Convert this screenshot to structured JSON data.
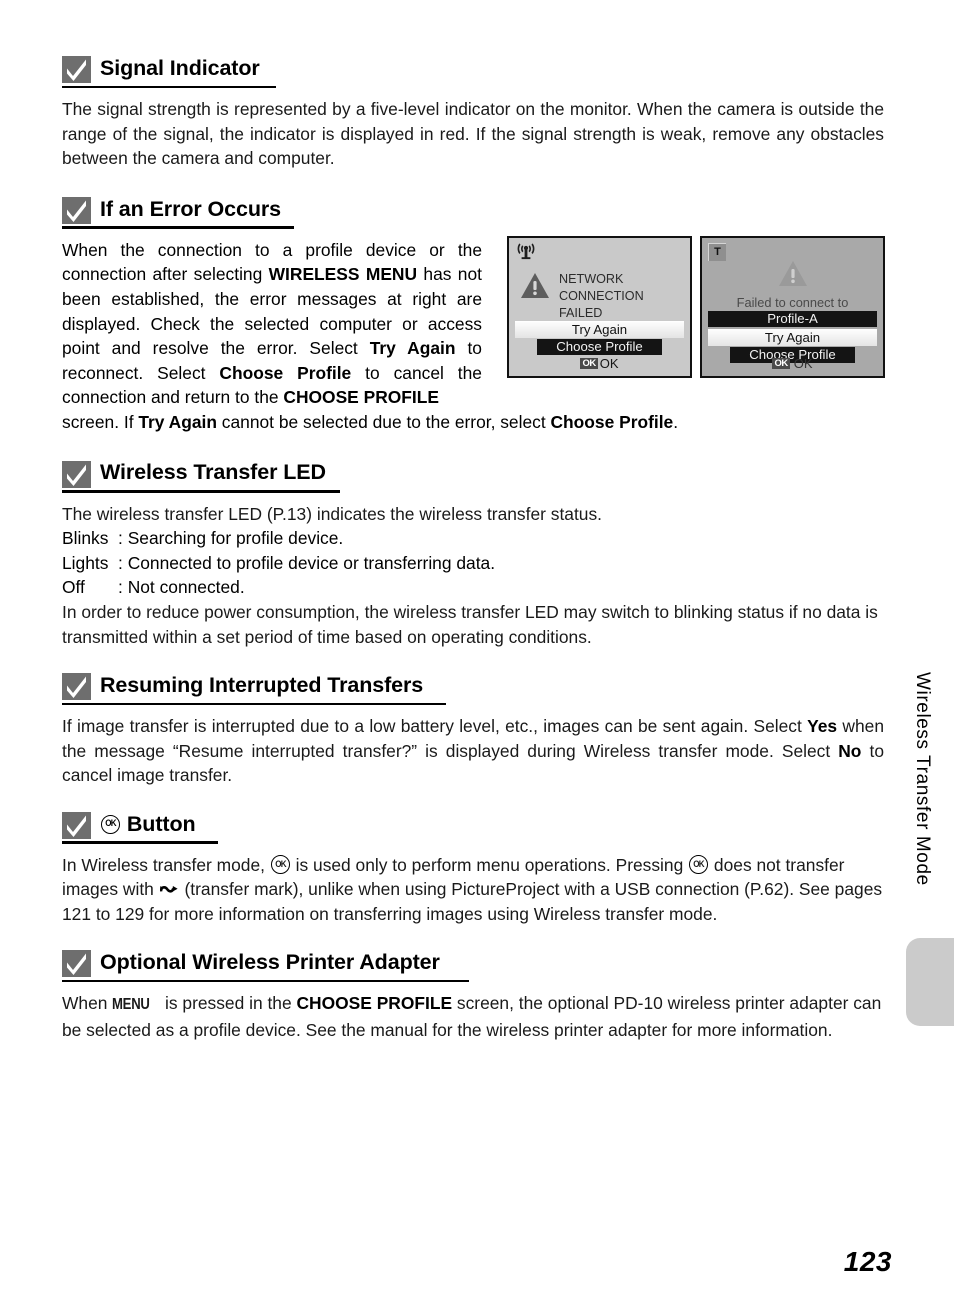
{
  "page": {
    "number": "123",
    "running_head": "Wireless Transfer Mode"
  },
  "sections": [
    {
      "id": "signal-indicator",
      "heading": "Signal Indicator",
      "body": "The signal strength is represented by a five-level indicator on the monitor. When the camera is outside the range of the signal, the indicator is displayed in red. If the signal strength is weak, remove any obstacles between the camera and computer."
    },
    {
      "id": "if-an-error-occurs",
      "heading": "If an Error Occurs",
      "body_part_1": "When the connection to a profile device or the connection after selecting ",
      "body_bold_1": "WIRELESS MENU",
      "body_part_2": " has not been established, the error messages at right are displayed. Check the selected computer or access point and resolve the error. Select ",
      "body_bold_2": "Try Again",
      "body_part_3": " to reconnect. Select ",
      "body_bold_3": "Choose Profile",
      "body_part_4": " to cancel the connection and return to the ",
      "body_bold_4": "CHOOSE PROFILE",
      "body_part_5": " screen. If ",
      "body_bold_5": "Try Again",
      "body_part_6": " cannot be selected due to the error, select ",
      "body_bold_6": "Choose Profile",
      "body_part_7": "."
    },
    {
      "id": "wireless-transfer-led",
      "heading": "Wireless Transfer LED",
      "intro": "The wireless transfer LED (P.13) indicates the wireless transfer status.",
      "items": [
        {
          "key": "Blinks",
          "sep": ":",
          "value": "Searching for profile device."
        },
        {
          "key": "Lights",
          "sep": ":",
          "value": "Connected to profile device or transferring data."
        },
        {
          "key": "Off",
          "sep": ":",
          "value": "Not connected."
        }
      ],
      "outro": "In order to reduce power consumption, the wireless transfer LED may switch to blinking status if no data is transmitted within a set period of time based on operating conditions."
    },
    {
      "id": "resuming-interrupted-transfers",
      "heading": "Resuming Interrupted Transfers",
      "body_part_1": "If image transfer is interrupted due to a low battery level, etc., images can be sent again. Select ",
      "body_bold_1": "Yes",
      "body_part_2": " when the message “Resume interrupted transfer?” is displayed during Wireless transfer mode. Select ",
      "body_bold_2": "No",
      "body_part_3": " to cancel image transfer."
    },
    {
      "id": "ok-button",
      "heading_suffix": "Button",
      "heading_icon": "ok-button-icon",
      "body_part_1": "In Wireless transfer mode, ",
      "body_part_2": " is used only to perform menu operations. Pressing ",
      "body_part_3": " does not transfer images with ",
      "body_part_4": " (transfer mark), unlike when using PictureProject with a USB connection (P.62). See pages 121 to 129 for more information on transferring images using Wireless transfer mode."
    },
    {
      "id": "optional-wireless-printer-adapter",
      "heading": "Optional Wireless Printer Adapter",
      "body_part_1": "When ",
      "body_menu": "MENU",
      "body_part_2": " is pressed in the ",
      "body_bold_1": "CHOOSE PROFILE",
      "body_part_3": " screen, the optional PD-10 wireless printer adapter can be selected as a profile device. See the manual for the wireless printer adapter for more information."
    }
  ],
  "screens": [
    {
      "id": "network-connection-failed",
      "status_icon": "wireless-antenna-icon",
      "warning_icon": "warning-triangle-icon",
      "message_line_1": "NETWORK CONNECTION",
      "message_line_2": "FAILED",
      "options": [
        {
          "label": "Try Again",
          "style": "highlighted"
        },
        {
          "label": "Choose Profile",
          "style": "dark"
        }
      ],
      "confirm_badge": "OK",
      "confirm_label": "OK"
    },
    {
      "id": "failed-to-connect-to-profile-a",
      "status_icon": "transfer-t-icon",
      "status_icon_label": "T",
      "warning_icon": "warning-triangle-icon",
      "message_line_1": "Failed to connect to",
      "options": [
        {
          "label": "Profile-A",
          "style": "dark"
        },
        {
          "label": "Try Again",
          "style": "highlighted"
        },
        {
          "label": "Choose Profile",
          "style": "dark"
        }
      ],
      "confirm_badge": "OK",
      "confirm_label": "OK"
    }
  ],
  "colors": {
    "icon_gray": "#6e6e6e",
    "lcd_a_bg": "#c9c9c9",
    "lcd_b_bg": "#a9a9a9",
    "tab_gray": "#cbcbcb",
    "option_dark": "#141414"
  }
}
